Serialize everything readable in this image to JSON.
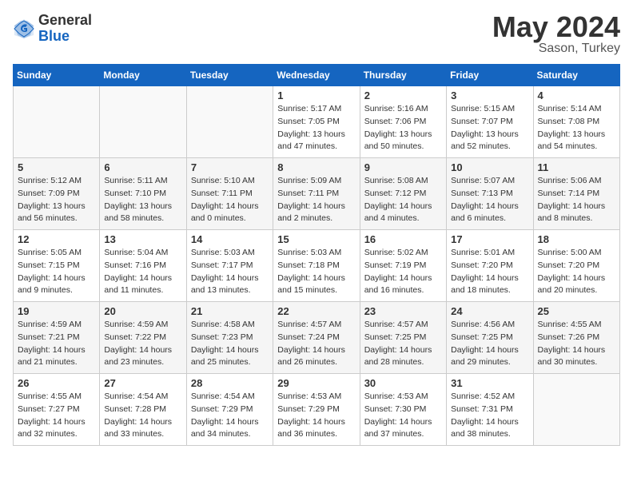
{
  "header": {
    "logo_general": "General",
    "logo_blue": "Blue",
    "month_title": "May 2024",
    "location": "Sason, Turkey"
  },
  "days_of_week": [
    "Sunday",
    "Monday",
    "Tuesday",
    "Wednesday",
    "Thursday",
    "Friday",
    "Saturday"
  ],
  "weeks": [
    [
      {
        "day": "",
        "info": []
      },
      {
        "day": "",
        "info": []
      },
      {
        "day": "",
        "info": []
      },
      {
        "day": "1",
        "info": [
          "Sunrise: 5:17 AM",
          "Sunset: 7:05 PM",
          "Daylight: 13 hours",
          "and 47 minutes."
        ]
      },
      {
        "day": "2",
        "info": [
          "Sunrise: 5:16 AM",
          "Sunset: 7:06 PM",
          "Daylight: 13 hours",
          "and 50 minutes."
        ]
      },
      {
        "day": "3",
        "info": [
          "Sunrise: 5:15 AM",
          "Sunset: 7:07 PM",
          "Daylight: 13 hours",
          "and 52 minutes."
        ]
      },
      {
        "day": "4",
        "info": [
          "Sunrise: 5:14 AM",
          "Sunset: 7:08 PM",
          "Daylight: 13 hours",
          "and 54 minutes."
        ]
      }
    ],
    [
      {
        "day": "5",
        "info": [
          "Sunrise: 5:12 AM",
          "Sunset: 7:09 PM",
          "Daylight: 13 hours",
          "and 56 minutes."
        ]
      },
      {
        "day": "6",
        "info": [
          "Sunrise: 5:11 AM",
          "Sunset: 7:10 PM",
          "Daylight: 13 hours",
          "and 58 minutes."
        ]
      },
      {
        "day": "7",
        "info": [
          "Sunrise: 5:10 AM",
          "Sunset: 7:11 PM",
          "Daylight: 14 hours",
          "and 0 minutes."
        ]
      },
      {
        "day": "8",
        "info": [
          "Sunrise: 5:09 AM",
          "Sunset: 7:11 PM",
          "Daylight: 14 hours",
          "and 2 minutes."
        ]
      },
      {
        "day": "9",
        "info": [
          "Sunrise: 5:08 AM",
          "Sunset: 7:12 PM",
          "Daylight: 14 hours",
          "and 4 minutes."
        ]
      },
      {
        "day": "10",
        "info": [
          "Sunrise: 5:07 AM",
          "Sunset: 7:13 PM",
          "Daylight: 14 hours",
          "and 6 minutes."
        ]
      },
      {
        "day": "11",
        "info": [
          "Sunrise: 5:06 AM",
          "Sunset: 7:14 PM",
          "Daylight: 14 hours",
          "and 8 minutes."
        ]
      }
    ],
    [
      {
        "day": "12",
        "info": [
          "Sunrise: 5:05 AM",
          "Sunset: 7:15 PM",
          "Daylight: 14 hours",
          "and 9 minutes."
        ]
      },
      {
        "day": "13",
        "info": [
          "Sunrise: 5:04 AM",
          "Sunset: 7:16 PM",
          "Daylight: 14 hours",
          "and 11 minutes."
        ]
      },
      {
        "day": "14",
        "info": [
          "Sunrise: 5:03 AM",
          "Sunset: 7:17 PM",
          "Daylight: 14 hours",
          "and 13 minutes."
        ]
      },
      {
        "day": "15",
        "info": [
          "Sunrise: 5:03 AM",
          "Sunset: 7:18 PM",
          "Daylight: 14 hours",
          "and 15 minutes."
        ]
      },
      {
        "day": "16",
        "info": [
          "Sunrise: 5:02 AM",
          "Sunset: 7:19 PM",
          "Daylight: 14 hours",
          "and 16 minutes."
        ]
      },
      {
        "day": "17",
        "info": [
          "Sunrise: 5:01 AM",
          "Sunset: 7:20 PM",
          "Daylight: 14 hours",
          "and 18 minutes."
        ]
      },
      {
        "day": "18",
        "info": [
          "Sunrise: 5:00 AM",
          "Sunset: 7:20 PM",
          "Daylight: 14 hours",
          "and 20 minutes."
        ]
      }
    ],
    [
      {
        "day": "19",
        "info": [
          "Sunrise: 4:59 AM",
          "Sunset: 7:21 PM",
          "Daylight: 14 hours",
          "and 21 minutes."
        ]
      },
      {
        "day": "20",
        "info": [
          "Sunrise: 4:59 AM",
          "Sunset: 7:22 PM",
          "Daylight: 14 hours",
          "and 23 minutes."
        ]
      },
      {
        "day": "21",
        "info": [
          "Sunrise: 4:58 AM",
          "Sunset: 7:23 PM",
          "Daylight: 14 hours",
          "and 25 minutes."
        ]
      },
      {
        "day": "22",
        "info": [
          "Sunrise: 4:57 AM",
          "Sunset: 7:24 PM",
          "Daylight: 14 hours",
          "and 26 minutes."
        ]
      },
      {
        "day": "23",
        "info": [
          "Sunrise: 4:57 AM",
          "Sunset: 7:25 PM",
          "Daylight: 14 hours",
          "and 28 minutes."
        ]
      },
      {
        "day": "24",
        "info": [
          "Sunrise: 4:56 AM",
          "Sunset: 7:25 PM",
          "Daylight: 14 hours",
          "and 29 minutes."
        ]
      },
      {
        "day": "25",
        "info": [
          "Sunrise: 4:55 AM",
          "Sunset: 7:26 PM",
          "Daylight: 14 hours",
          "and 30 minutes."
        ]
      }
    ],
    [
      {
        "day": "26",
        "info": [
          "Sunrise: 4:55 AM",
          "Sunset: 7:27 PM",
          "Daylight: 14 hours",
          "and 32 minutes."
        ]
      },
      {
        "day": "27",
        "info": [
          "Sunrise: 4:54 AM",
          "Sunset: 7:28 PM",
          "Daylight: 14 hours",
          "and 33 minutes."
        ]
      },
      {
        "day": "28",
        "info": [
          "Sunrise: 4:54 AM",
          "Sunset: 7:29 PM",
          "Daylight: 14 hours",
          "and 34 minutes."
        ]
      },
      {
        "day": "29",
        "info": [
          "Sunrise: 4:53 AM",
          "Sunset: 7:29 PM",
          "Daylight: 14 hours",
          "and 36 minutes."
        ]
      },
      {
        "day": "30",
        "info": [
          "Sunrise: 4:53 AM",
          "Sunset: 7:30 PM",
          "Daylight: 14 hours",
          "and 37 minutes."
        ]
      },
      {
        "day": "31",
        "info": [
          "Sunrise: 4:52 AM",
          "Sunset: 7:31 PM",
          "Daylight: 14 hours",
          "and 38 minutes."
        ]
      },
      {
        "day": "",
        "info": []
      }
    ]
  ]
}
